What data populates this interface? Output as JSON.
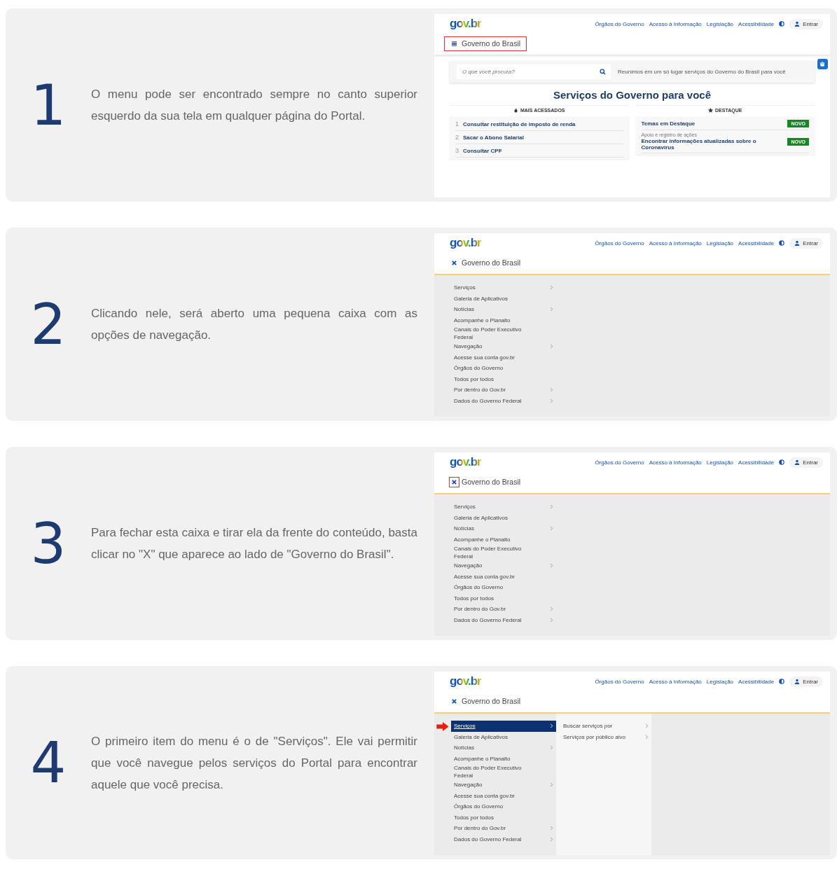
{
  "steps": [
    {
      "number": "1",
      "text": "O menu pode ser encontrado sempre no canto superior esquerdo da sua tela em qualquer página do Portal.",
      "screen": {
        "kind": "home",
        "logo": "gov.br",
        "nav_links": [
          "Órgãos do Governo",
          "Acesso à Informação",
          "Legislação",
          "Acessibilidade"
        ],
        "login": "Entrar",
        "toggle": {
          "kind": "menu",
          "label": "Governo do Brasil",
          "framed": true,
          "icon_framed": false
        },
        "search_placeholder": "O que você procura?",
        "tagline": "Reunimos em um só lugar serviços do Governo do Brasil para você",
        "title": "Serviços do Governo para você",
        "most_accessed": {
          "heading": "MAIS ACESSADOS",
          "items": [
            {
              "rank": "1",
              "label": "Consultar restituição de imposto de renda"
            },
            {
              "rank": "2",
              "label": "Sacar o Abono Salarial"
            },
            {
              "rank": "3",
              "label": "Consultar CPF"
            }
          ]
        },
        "highlights": {
          "heading": "DESTAQUE",
          "items": [
            {
              "label": "Temas em Destaque",
              "badge": "NOVO"
            },
            {
              "caption": "Apoio e registro de ações",
              "label": "Encontrar informações atualizadas sobre o Coronavírus",
              "badge": "NOVO"
            }
          ]
        }
      }
    },
    {
      "number": "2",
      "text": "Clicando nele, será aberto uma pequena caixa com as opções de navegação.",
      "screen": {
        "kind": "menu",
        "logo": "gov.br",
        "nav_links": [
          "Órgãos do Governo",
          "Acesso à Informação",
          "Legislação",
          "Acessibilidade"
        ],
        "login": "Entrar",
        "toggle": {
          "kind": "close",
          "label": "Governo do Brasil",
          "framed": false,
          "icon_framed": false
        },
        "menu_items": [
          {
            "label": "Serviços",
            "submenu": true,
            "selected": false
          },
          {
            "label": "Galeria de Aplicativos",
            "submenu": false,
            "selected": false
          },
          {
            "label": "Notícias",
            "submenu": true,
            "selected": false
          },
          {
            "label": "Acompanhe o Planalto",
            "submenu": false,
            "selected": false
          },
          {
            "label": "Canais do Poder Executivo Federal",
            "submenu": false,
            "selected": false
          },
          {
            "label": "Navegação",
            "submenu": true,
            "selected": false
          },
          {
            "label": "Acesse sua conta gov.br",
            "submenu": false,
            "selected": false
          },
          {
            "label": "Órgãos do Governo",
            "submenu": false,
            "selected": false
          },
          {
            "label": "Todos por todos",
            "submenu": false,
            "selected": false
          },
          {
            "label": "Por dentro do Gov.br",
            "submenu": true,
            "selected": false
          },
          {
            "label": "Dados do Governo Federal",
            "submenu": true,
            "selected": false
          }
        ]
      }
    },
    {
      "number": "3",
      "text": "Para fechar esta caixa e tirar ela da frente do conteúdo, basta clicar no \"X\" que aparece ao lado de \"Governo do Brasil\".",
      "screen": {
        "kind": "menu",
        "logo": "gov.br",
        "nav_links": [
          "Órgãos do Governo",
          "Acesso à Informação",
          "Legislação",
          "Acessibilidade"
        ],
        "login": "Entrar",
        "toggle": {
          "kind": "close",
          "label": "Governo do Brasil",
          "framed": false,
          "icon_framed": true
        },
        "menu_items": [
          {
            "label": "Serviços",
            "submenu": true,
            "selected": false
          },
          {
            "label": "Galeria de Aplicativos",
            "submenu": false,
            "selected": false
          },
          {
            "label": "Notícias",
            "submenu": true,
            "selected": false
          },
          {
            "label": "Acompanhe o Planalto",
            "submenu": false,
            "selected": false
          },
          {
            "label": "Canais do Poder Executivo Federal",
            "submenu": false,
            "selected": false
          },
          {
            "label": "Navegação",
            "submenu": true,
            "selected": false
          },
          {
            "label": "Acesse sua conta gov.br",
            "submenu": false,
            "selected": false
          },
          {
            "label": "Órgãos do Governo",
            "submenu": false,
            "selected": false
          },
          {
            "label": "Todos por todos",
            "submenu": false,
            "selected": false
          },
          {
            "label": "Por dentro do Gov.br",
            "submenu": true,
            "selected": false
          },
          {
            "label": "Dados do Governo Federal",
            "submenu": true,
            "selected": false
          }
        ]
      }
    },
    {
      "number": "4",
      "text": "O primeiro item do menu é o de \"Serviços\". Ele vai permitir que você navegue pelos serviços do Portal para encontrar aquele que você precisa.",
      "screen": {
        "kind": "menu",
        "logo": "gov.br",
        "nav_links": [
          "Órgãos do Governo",
          "Acesso à Informação",
          "Legislação",
          "Acessibilidade"
        ],
        "login": "Entrar",
        "toggle": {
          "kind": "close",
          "label": "Governo do Brasil",
          "framed": false,
          "icon_framed": false
        },
        "pointer_arrow": true,
        "menu_items": [
          {
            "label": "Serviços",
            "submenu": true,
            "selected": true
          },
          {
            "label": "Galeria de Aplicativos",
            "submenu": false,
            "selected": false
          },
          {
            "label": "Notícias",
            "submenu": true,
            "selected": false
          },
          {
            "label": "Acompanhe o Planalto",
            "submenu": false,
            "selected": false
          },
          {
            "label": "Canais do Poder Executivo Federal",
            "submenu": false,
            "selected": false
          },
          {
            "label": "Navegação",
            "submenu": true,
            "selected": false
          },
          {
            "label": "Acesse sua conta gov.br",
            "submenu": false,
            "selected": false
          },
          {
            "label": "Órgãos do Governo",
            "submenu": false,
            "selected": false
          },
          {
            "label": "Todos por todos",
            "submenu": false,
            "selected": false
          },
          {
            "label": "Por dentro do Gov.br",
            "submenu": true,
            "selected": false
          },
          {
            "label": "Dados do Governo Federal",
            "submenu": true,
            "selected": false
          }
        ],
        "submenu_items": [
          {
            "label": "Buscar serviços por",
            "submenu": true
          },
          {
            "label": "Serviços por público alvo",
            "submenu": true
          }
        ]
      }
    }
  ]
}
